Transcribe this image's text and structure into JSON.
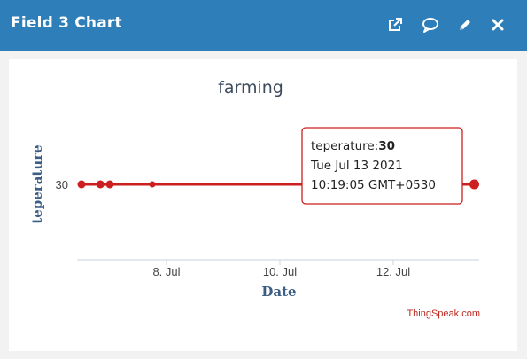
{
  "window": {
    "title": "Field 3 Chart",
    "icons": [
      "external-link-icon",
      "comment-icon",
      "pencil-icon",
      "close-icon"
    ]
  },
  "colors": {
    "titlebar": "#2d7eb9",
    "series": "#cc1f1f",
    "axis_label": "#3c5d84"
  },
  "chart_data": {
    "type": "line",
    "title": "farming",
    "xlabel": "Date",
    "ylabel": "teperature",
    "x_ticks": [
      "8. Jul",
      "10. Jul",
      "12. Jul"
    ],
    "y_ticks": [
      "30"
    ],
    "grid": false,
    "series": [
      {
        "name": "teperature",
        "points": [
          {
            "x": "2021-07-06T12:00",
            "y": 30
          },
          {
            "x": "2021-07-06T20:00",
            "y": 30
          },
          {
            "x": "2021-07-07T00:00",
            "y": 30
          },
          {
            "x": "2021-07-07T18:00",
            "y": 30
          },
          {
            "x": "2021-07-13T10:19:05",
            "y": 30
          }
        ]
      }
    ],
    "tooltip": {
      "label": "teperature:",
      "value": "30",
      "date": "Tue Jul 13 2021",
      "time": "10:19:05 GMT+0530"
    },
    "credits": "ThingSpeak.com"
  }
}
